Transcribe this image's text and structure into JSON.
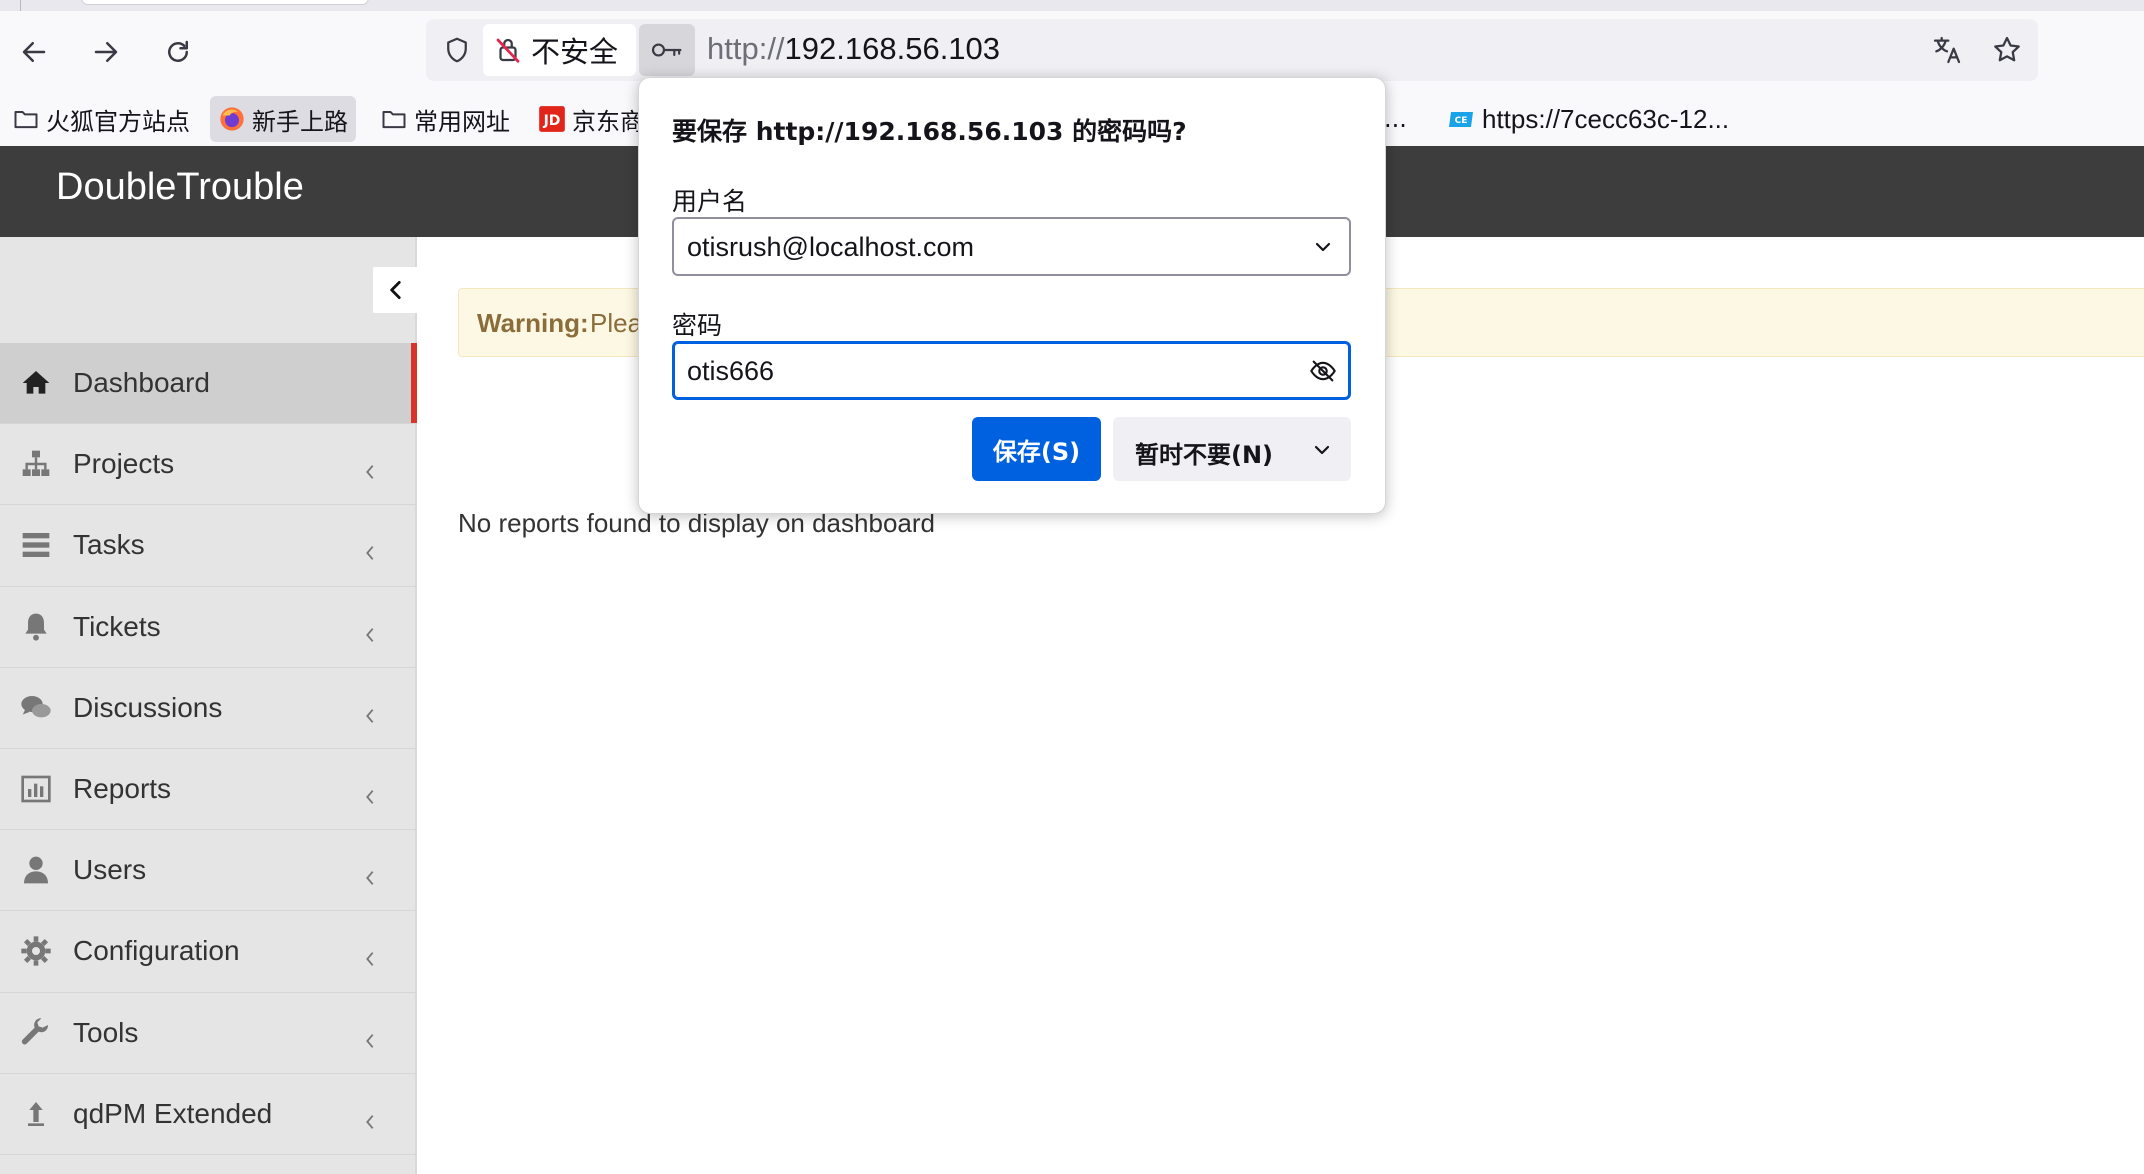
{
  "browser": {
    "security_label": "不安全",
    "url_protocol": "http://",
    "url_host": "192.168.56.103"
  },
  "bookmarks": [
    {
      "label": "火狐官方站点",
      "icon": "folder-icon"
    },
    {
      "label": "新手上路",
      "icon": "firefox-icon"
    },
    {
      "label": "常用网址",
      "icon": "folder-icon"
    },
    {
      "label": "京东商",
      "icon": "jd-icon"
    },
    {
      "label": "...",
      "icon": ""
    },
    {
      "label": "https://7cecc63c-12...",
      "icon": "ce-icon"
    }
  ],
  "app": {
    "brand": "DoubleTrouble"
  },
  "sidebar": {
    "items": [
      {
        "label": "Dashboard",
        "icon": "home-icon",
        "active": true
      },
      {
        "label": "Projects",
        "icon": "sitemap-icon"
      },
      {
        "label": "Tasks",
        "icon": "tasks-icon"
      },
      {
        "label": "Tickets",
        "icon": "bell-icon"
      },
      {
        "label": "Discussions",
        "icon": "comments-icon"
      },
      {
        "label": "Reports",
        "icon": "bar-chart-icon"
      },
      {
        "label": "Users",
        "icon": "user-icon"
      },
      {
        "label": "Configuration",
        "icon": "gear-icon"
      },
      {
        "label": "Tools",
        "icon": "wrench-icon"
      },
      {
        "label": "qdPM Extended",
        "icon": "upload-arrow-icon"
      }
    ]
  },
  "main": {
    "warning_strong": "Warning:",
    "warning_text": "Plea",
    "no_reports": "No reports found to display on dashboard"
  },
  "password_popup": {
    "title": "要保存 http://192.168.56.103 的密码吗?",
    "username_label": "用户名",
    "username_value": "otisrush@localhost.com",
    "password_label": "密码",
    "password_value": "otis666",
    "save_label": "保存(S)",
    "not_now_label": "暂时不要(N)"
  },
  "colors": {
    "header_bg": "#3d3d3d",
    "sidebar_bg": "#e5e5e5",
    "active_marker": "#d9342b",
    "primary_button": "#0061e0",
    "warning_bg": "#fcf8e3"
  }
}
